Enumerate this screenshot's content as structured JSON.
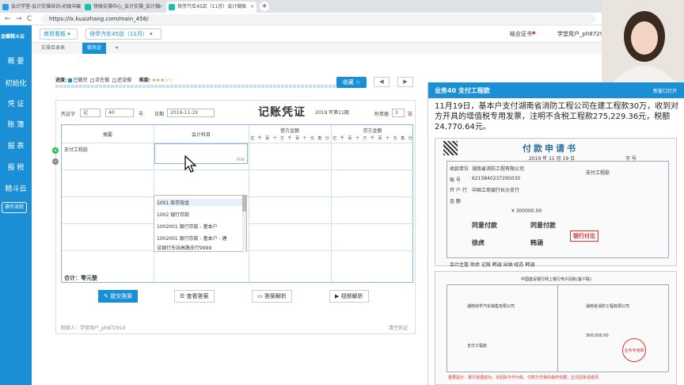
{
  "browser": {
    "tabs": [
      {
        "label": "会计学堂-会计实操培训-初级中级",
        "active": false
      },
      {
        "label": "快账实操中心_会计实操_会计做",
        "active": false
      },
      {
        "label": "快学汽车45店（11月）会计做账",
        "active": true
      }
    ],
    "url": "https://lx.kuaizhang.com/main_458/",
    "back": "←",
    "forward": "→",
    "reload": "C"
  },
  "sidebar": {
    "logo": "金蝶精斗云",
    "items": [
      "概 要",
      "初始化",
      "凭 证",
      "账 簿",
      "报 表",
      "报 税",
      "精斗云"
    ],
    "op_button": "操作流程"
  },
  "header": {
    "view_select": "商贸看板",
    "company_select": "快学汽车45店（11月）",
    "cert_text": "结业证书",
    "user_text": "学堂用户_ph87292"
  },
  "subtabs": [
    {
      "label": "实操目录表",
      "active": false
    },
    {
      "label": "做凭证",
      "active": true
    }
  ],
  "progress": {
    "label": "进度:",
    "done": "已做完",
    "doing": "正在做",
    "todo": "还没做",
    "difficulty_label": "难度:",
    "stars": "★★★☆☆",
    "collect_button": "收藏 ☆",
    "prev": "◀",
    "next": "▶"
  },
  "voucher": {
    "title": "记账凭证",
    "period": "2019 年第11期",
    "word_label": "凭证字",
    "word_value": "记",
    "number": "40",
    "number_suffix": "号",
    "date_label": "日期",
    "date_value": "2019-11-19",
    "attach_label": "附单据",
    "attach_value": "3",
    "attach_unit": "张",
    "col_summary": "摘要",
    "col_account": "会计科目",
    "col_debit": "借方金额",
    "col_credit": "贷方金额",
    "units": [
      "亿",
      "千",
      "百",
      "十",
      "万",
      "千",
      "百",
      "十",
      "元",
      "角",
      "分"
    ],
    "row1_summary": "支付工程款",
    "account_placeholder": "科目",
    "dropdown": [
      "1001 库存现金",
      "1002 银行存款",
      "1002001 银行存款 - 基本户",
      "1002001 银行存款 - 基本户 - 建",
      "设银行东站高路支行9999"
    ],
    "total_label": "合计：零元整",
    "maker": "制单人：学堂用户_ph872910",
    "clear": "清空凭证"
  },
  "actions": {
    "submit": "提交答案",
    "view_answer": "查看答案",
    "analysis": "答案解析",
    "video": "视频解析"
  },
  "task": {
    "title": "业务40 支付工程款",
    "open_new": "新窗口打开",
    "description": "11月19日，基本户支付湖南省消防工程公司在建工程款30万，收到对方开具的增值税专用发票，注明不含税工程款275,229.36元，税额24,770.64元。"
  },
  "doc_payment": {
    "title": "付款申请书",
    "date": "2019 年 11 月 19 日",
    "serial_label": "字 号",
    "payee_label": "收款单位",
    "payee": "湖南省消防工程有限公司",
    "purpose": "支付工程款",
    "account_label": "账 号",
    "account": "6215840237295030",
    "bank_label": "开 户 行",
    "bank": "中国工商银行长沙支行",
    "amount_label": "金 额",
    "amount": "¥ 300000.00",
    "approve": "同意付款",
    "approver": "徐虎",
    "finance": "同意付款",
    "finance_person": "韩涵",
    "stamp": "银行付讫",
    "footer": "会计主管 徐虎  记账 韩涵  出纳  经办 韩涵"
  },
  "doc_bank": {
    "title": "中国建设银行网上银行电子回执(客户联)",
    "payer": "湖南快学汽车销售有限公司",
    "payee": "湖南省消防工程有限公司",
    "amount": "300,000.00",
    "purpose": "支付工程款",
    "stamp": "业务专用章",
    "note": "重要提示：银行受理成功，本回执不作为收、付款方交易的最终依据，正式回单请查阅"
  }
}
